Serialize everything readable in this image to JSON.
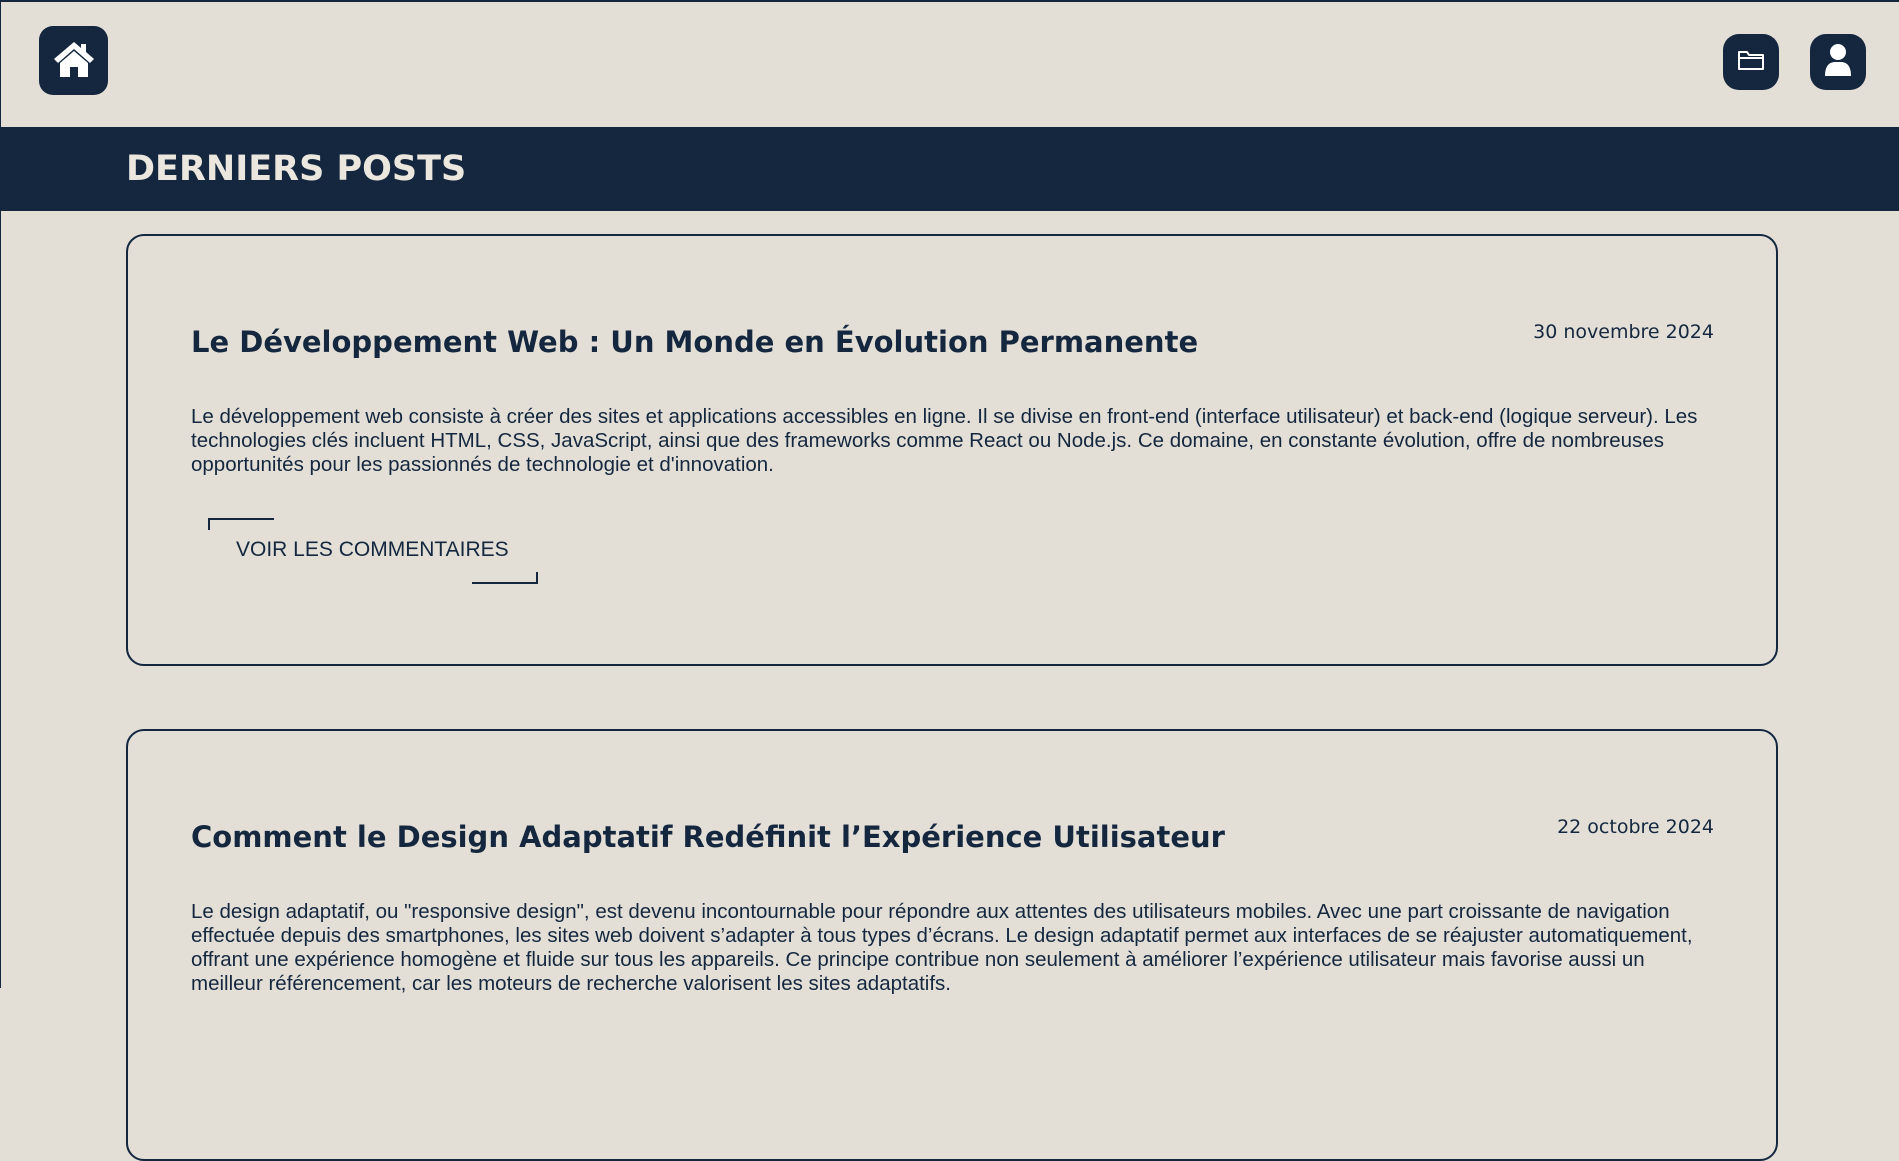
{
  "header": {
    "home_icon": "home-icon",
    "folder_icon": "folder-icon",
    "user_icon": "user-icon",
    "accent_color": "#14273e",
    "background_color": "#e3dfd7"
  },
  "section": {
    "title": "DERNIERS POSTS"
  },
  "posts": [
    {
      "title": "Le Développement Web : Un Monde en Évolution Permanente",
      "date": "30 novembre 2024",
      "body": "Le développement web consiste à créer des sites et applications accessibles en ligne. Il se divise en front-end (interface utilisateur) et back-end (logique serveur). Les technologies clés incluent HTML, CSS, JavaScript, ainsi que des frameworks comme React ou Node.js. Ce domaine, en constante évolution, offre de nombreuses opportunités pour les passionnés de technologie et d'innovation.",
      "comments_label": "VOIR LES COMMENTAIRES"
    },
    {
      "title": "Comment le Design Adaptatif Redéfinit l’Expérience Utilisateur",
      "date": "22 octobre 2024",
      "body": "Le design adaptatif, ou \"responsive design\", est devenu incontournable pour répondre aux attentes des utilisateurs mobiles. Avec une part croissante de navigation effectuée depuis des smartphones, les sites web doivent s’adapter à tous types d’écrans. Le design adaptatif permet aux interfaces de se réajuster automatiquement, offrant une expérience homogène et fluide sur tous les appareils. Ce principe contribue non seulement à améliorer l’expérience utilisateur mais favorise aussi un meilleur référencement, car les moteurs de recherche valorisent les sites adaptatifs."
    }
  ]
}
